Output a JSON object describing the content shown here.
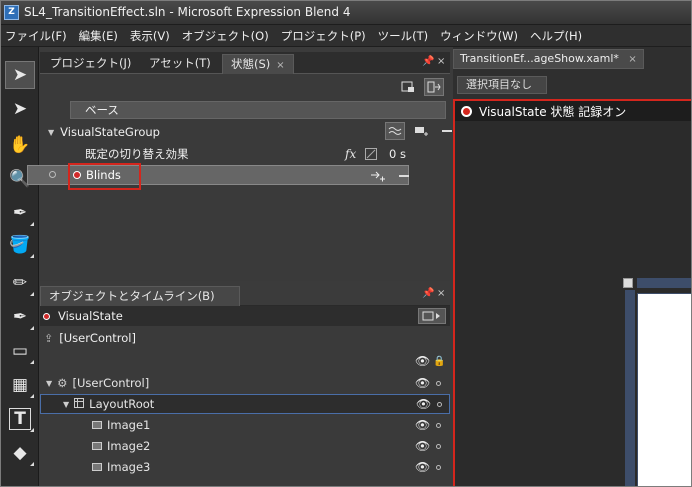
{
  "window": {
    "title": "SL4_TransitionEffect.sln - Microsoft Expression Blend 4",
    "app_icon_glyph": "Z"
  },
  "menu": [
    "ファイル(F)",
    "編集(E)",
    "表示(V)",
    "オブジェクト(O)",
    "プロジェクト(P)",
    "ツール(T)",
    "ウィンドウ(W)",
    "ヘルプ(H)"
  ],
  "tools": [
    {
      "name": "selection-tool",
      "glyph": "➤",
      "active": true
    },
    {
      "name": "direct-selection-tool",
      "glyph": "➤"
    },
    {
      "name": "pan-tool",
      "glyph": "✋"
    },
    {
      "name": "zoom-tool",
      "glyph": "🔍"
    },
    {
      "name": "eyedropper-tool",
      "glyph": "✒"
    },
    {
      "name": "paint-bucket-tool",
      "glyph": "🪣"
    },
    {
      "name": "pencil-tool",
      "glyph": "✏"
    },
    {
      "name": "pen-tool",
      "glyph": "✒"
    },
    {
      "name": "rectangle-tool",
      "glyph": "▭"
    },
    {
      "name": "grid-tool",
      "glyph": "▦"
    },
    {
      "name": "text-tool",
      "glyph": "T"
    },
    {
      "name": "assets-tool",
      "glyph": "◆"
    }
  ],
  "states_panel": {
    "tabs": [
      {
        "label": "プロジェクト(J)"
      },
      {
        "label": "アセット(T)"
      },
      {
        "label": "状態(S)",
        "close": "×"
      }
    ],
    "pin": "📌",
    "close": "×",
    "base_label": "ベース",
    "group_label": "VisualStateGroup",
    "transition_label": "既定の切り替え効果",
    "transition_time": "0 s",
    "state_label": "Blinds",
    "fx_glyph": "fx",
    "expand_glyph": "▼"
  },
  "objects_panel": {
    "title": "オブジェクトとタイムライン(B)",
    "pin": "📌",
    "close": "×",
    "state_label": "VisualState",
    "scope_label": "[UserControl]",
    "tree": [
      {
        "label": "[UserControl]",
        "indent": 0,
        "expander": "▼"
      },
      {
        "label": "LayoutRoot",
        "indent": 1,
        "expander": "▼",
        "selected": true
      },
      {
        "label": "Image1",
        "indent": 2
      },
      {
        "label": "Image2",
        "indent": 2
      },
      {
        "label": "Image3",
        "indent": 2
      }
    ]
  },
  "document": {
    "tab_label": "TransitionEf...ageShow.xaml*",
    "tab_close": "×",
    "selection_label": "選択項目なし",
    "recording_text": "VisualState 状態 記録オン"
  },
  "colors": {
    "recording_red": "#d4261d",
    "selection_blue": "#4a6ea8"
  }
}
